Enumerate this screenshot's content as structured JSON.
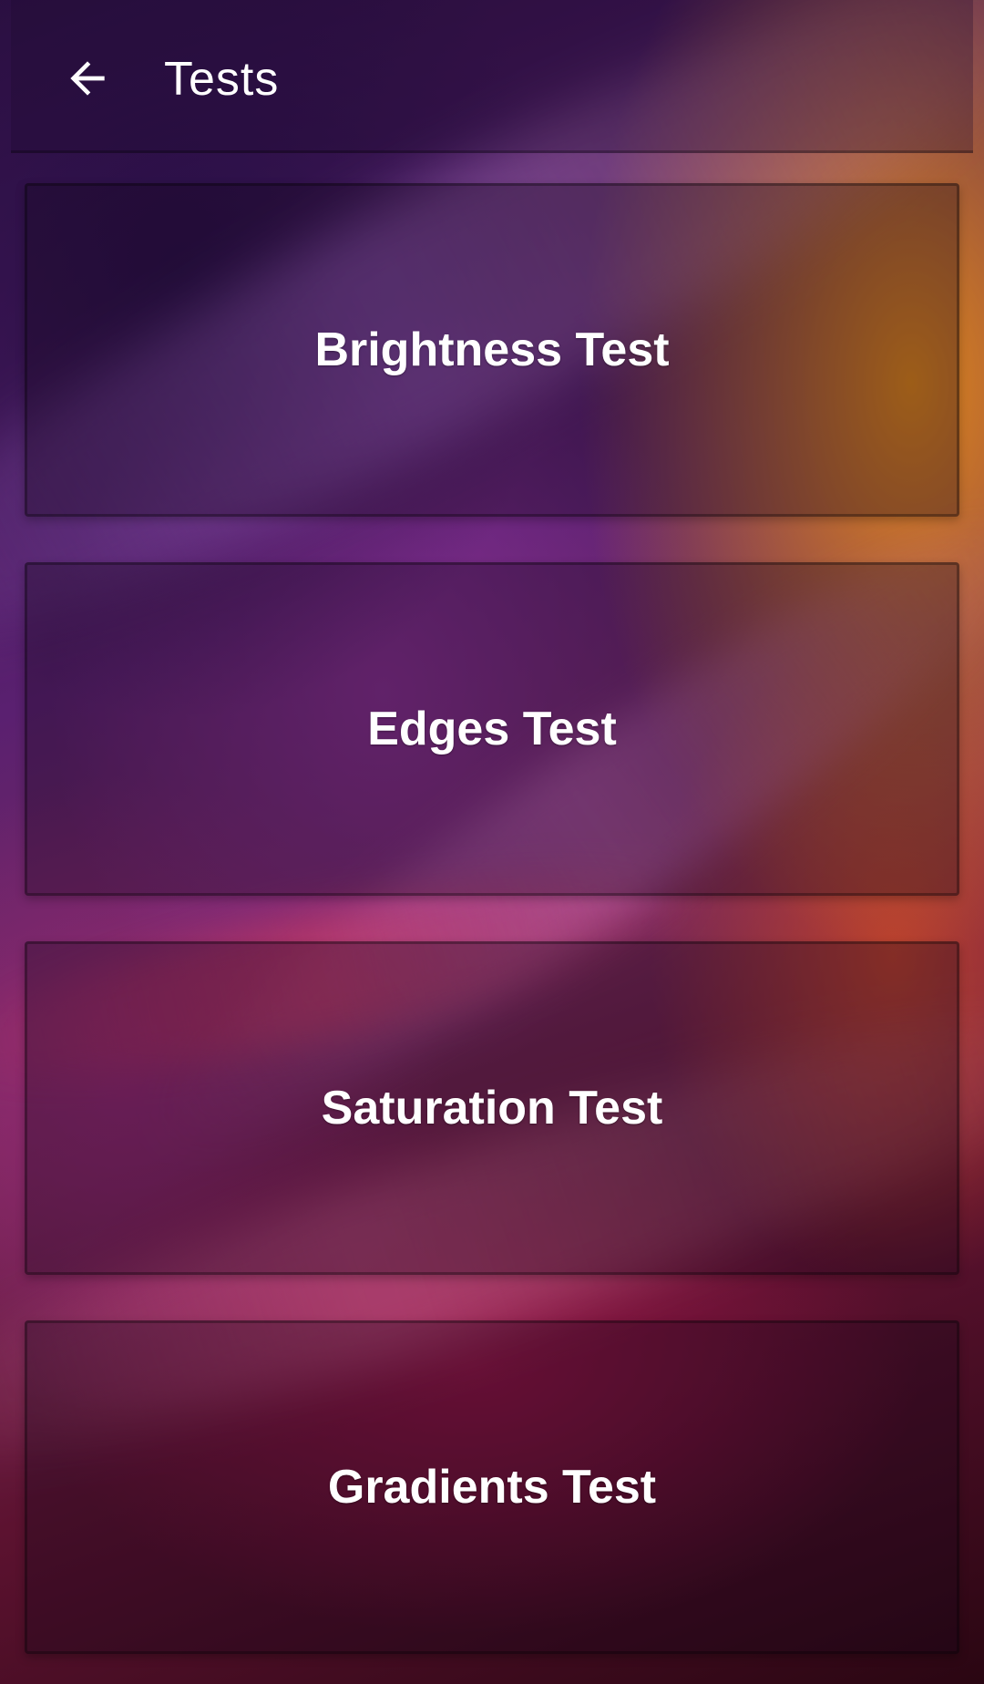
{
  "app_bar": {
    "title": "Tests",
    "back_icon": "arrow-back-icon"
  },
  "tests": [
    {
      "label": "Brightness Test"
    },
    {
      "label": "Edges Test"
    },
    {
      "label": "Saturation Test"
    },
    {
      "label": "Gradients Test"
    }
  ],
  "colors": {
    "text": "#ffffff",
    "card_overlay": "rgba(20,5,25,0.32)",
    "wallpaper_purple": "#5a2070",
    "wallpaper_orange": "#e68c14",
    "wallpaper_crimson": "#5c1230"
  }
}
